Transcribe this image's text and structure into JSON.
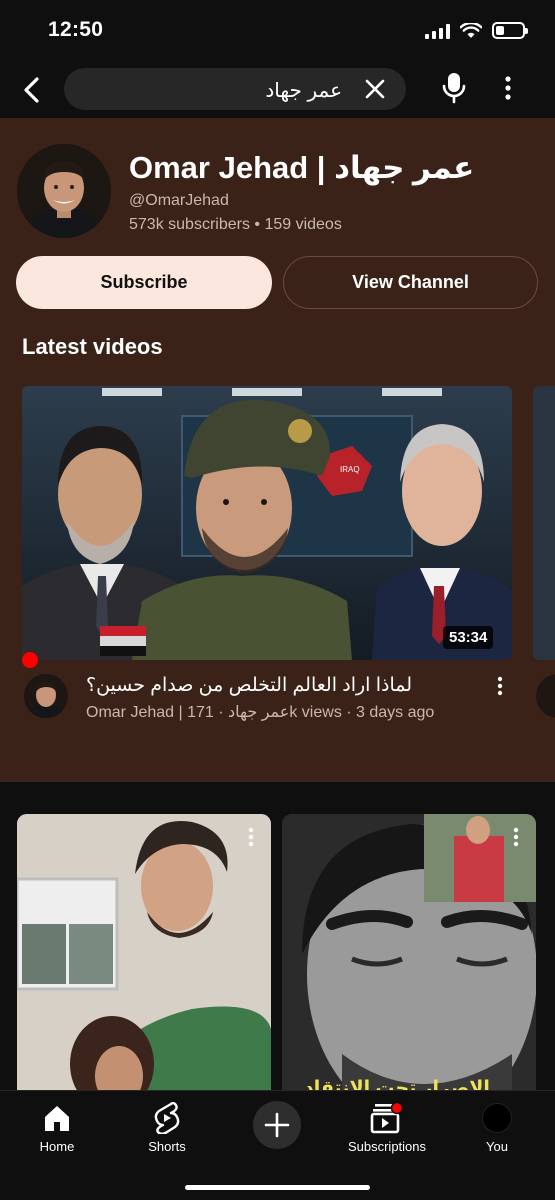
{
  "status_bar": {
    "time": "12:50",
    "battery_level": 0.3
  },
  "search": {
    "query": "عمر جهاد"
  },
  "channel": {
    "name": "Omar Jehad | عمر جهاد",
    "handle": "@OmarJehad",
    "meta": "573k subscribers • 159 videos",
    "subscribe_label": "Subscribe",
    "view_channel_label": "View Channel"
  },
  "latest": {
    "heading": "Latest videos",
    "video": {
      "title": "لماذا اراد العالم التخلص من صدام حسين؟",
      "meta": "Omar Jehad | عمر جهاد · 171k views · 3 days ago",
      "duration": "53:34",
      "thumbnail_badge": "IRAQ"
    }
  },
  "shorts": [
    {
      "caption": ""
    },
    {
      "caption": "الإصرار تحت الانتقاد"
    }
  ],
  "bottom_nav": [
    {
      "label": "Home",
      "icon": "home-icon"
    },
    {
      "label": "Shorts",
      "icon": "shorts-icon"
    },
    {
      "label": "",
      "icon": "create-icon"
    },
    {
      "label": "Subscriptions",
      "icon": "subscriptions-icon"
    },
    {
      "label": "You",
      "icon": "you-avatar"
    }
  ],
  "colors": {
    "card_bg": "#3a2219",
    "subscribe_bg": "#fbe7dd",
    "accent_red": "#ff0000"
  }
}
